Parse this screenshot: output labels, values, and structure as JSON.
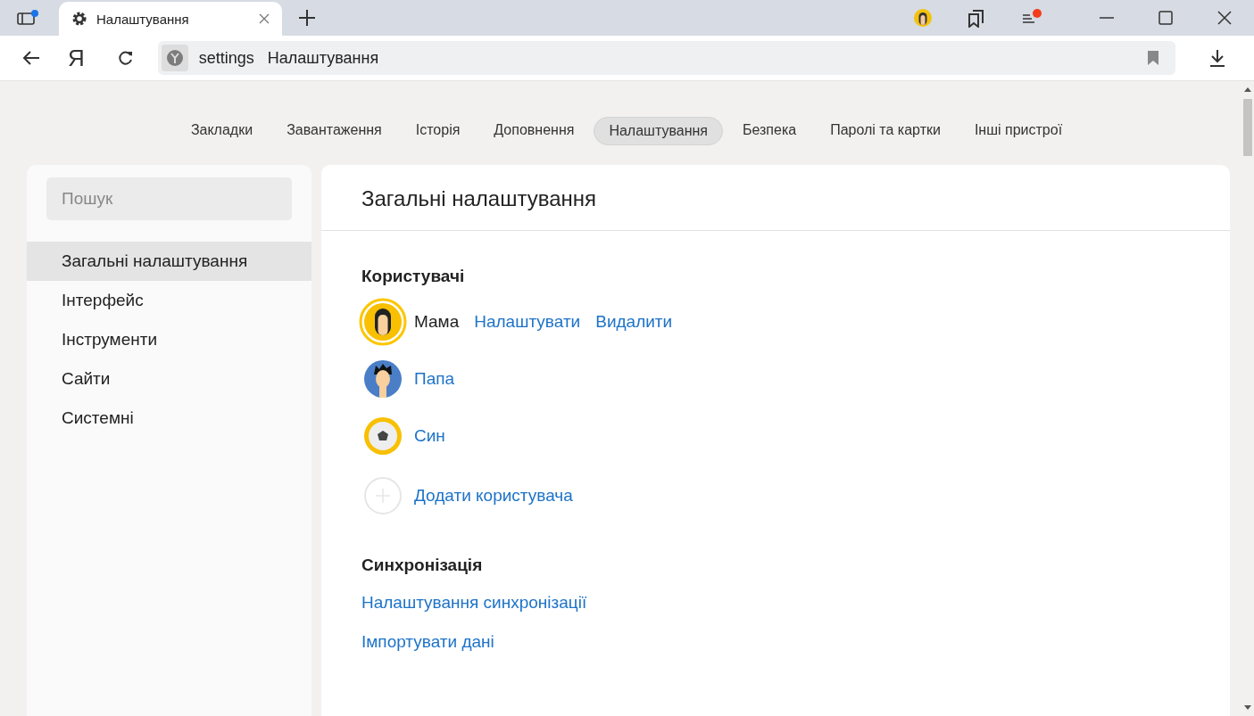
{
  "tab": {
    "title": "Налаштування"
  },
  "toolbar": {
    "logo": "Я",
    "address_host": "settings",
    "address_title": "Налаштування"
  },
  "nav": [
    {
      "label": "Закладки",
      "selected": false
    },
    {
      "label": "Завантаження",
      "selected": false
    },
    {
      "label": "Історія",
      "selected": false
    },
    {
      "label": "Доповнення",
      "selected": false
    },
    {
      "label": "Налаштування",
      "selected": true
    },
    {
      "label": "Безпека",
      "selected": false
    },
    {
      "label": "Паролі та картки",
      "selected": false
    },
    {
      "label": "Інші пристрої",
      "selected": false
    }
  ],
  "sidebar": {
    "search_placeholder": "Пошук",
    "items": [
      {
        "label": "Загальні налаштування",
        "selected": true
      },
      {
        "label": "Інтерфейс",
        "selected": false
      },
      {
        "label": "Інструменти",
        "selected": false
      },
      {
        "label": "Сайти",
        "selected": false
      },
      {
        "label": "Системні",
        "selected": false
      }
    ]
  },
  "panel": {
    "title": "Загальні налаштування",
    "users_heading": "Користувачі",
    "users": [
      {
        "name": "Мама",
        "kind": "woman",
        "selected": true,
        "actions": [
          "Налаштувати",
          "Видалити"
        ]
      },
      {
        "name": "Папа",
        "kind": "man",
        "selected": false
      },
      {
        "name": "Син",
        "kind": "ball",
        "selected": false
      }
    ],
    "add_user": "Додати користувача",
    "sync_heading": "Синхронізація",
    "sync_links": [
      "Налаштування синхронізації",
      "Імпортувати дані"
    ]
  }
}
